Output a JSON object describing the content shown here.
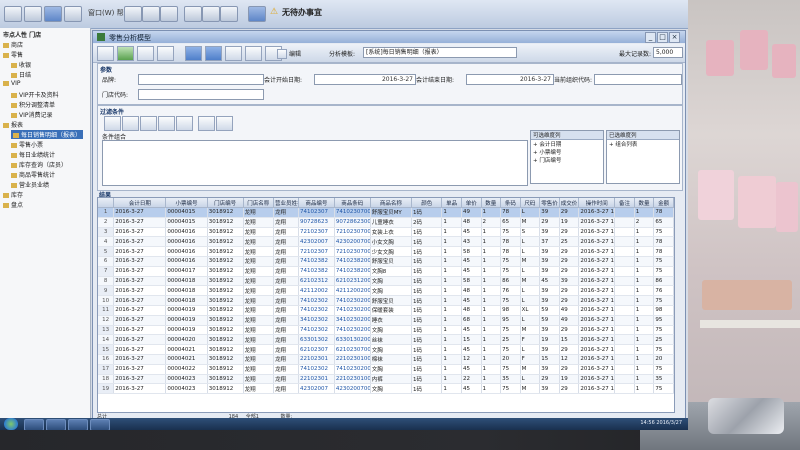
{
  "topbar": {
    "notice": "无待办事宜",
    "menu_text": "窗口(W)  帮助(H)"
  },
  "nav": {
    "store_title": "市点人性 门店",
    "items": [
      {
        "label": "商店",
        "level": 0
      },
      {
        "label": "零售",
        "level": 0
      },
      {
        "label": "收银",
        "level": 1
      },
      {
        "label": "日结",
        "level": 1
      },
      {
        "label": "VIP",
        "level": 0
      },
      {
        "label": "VIP开卡及资料",
        "level": 1
      },
      {
        "label": "积分调整清单",
        "level": 1
      },
      {
        "label": "VIP消费记录",
        "level": 1
      },
      {
        "label": "报表",
        "level": 0
      },
      {
        "label": "每日销售明细（报表）",
        "level": 1,
        "selected": true
      },
      {
        "label": "零售小票",
        "level": 1
      },
      {
        "label": "每日业绩统计",
        "level": 1
      },
      {
        "label": "库存查询（店员）",
        "level": 1
      },
      {
        "label": "商品零售统计",
        "level": 1
      },
      {
        "label": "营业员业绩",
        "level": 1
      },
      {
        "label": "库存",
        "level": 0
      },
      {
        "label": "盘点",
        "level": 0
      }
    ]
  },
  "window": {
    "title": "零售分析模型",
    "toolbar": {
      "edit_label": "编辑",
      "template_label": "分析模板:",
      "template_value": "[系统]每日销售明细（报表）",
      "max_records_label": "最大记录数:",
      "max_records_value": "5,000"
    },
    "params": {
      "section_title": "参数",
      "product_label": "品牌:",
      "store_label": "门店代码:",
      "start_label": "会计开始日期:",
      "start_value": "2016-3-27",
      "end_label": "会计结束日期:",
      "end_value": "2016-3-27",
      "vip_label": "当前组织代码:"
    },
    "filter": {
      "section_title": "过滤条件",
      "cond_title": "条件组合",
      "options_header": "可选维度列",
      "options": [
        "+ 会计日期",
        "+ 小票编号",
        "+ 门店编号"
      ],
      "selected_header": "已选维度列",
      "selected": [
        "+ 组合列表"
      ]
    },
    "grid": {
      "section_title": "结果",
      "columns": [
        "会计日期",
        "小票编号",
        "门店编号",
        "门店名称",
        "营业员姓名",
        "商品编号",
        "商品条码",
        "商品名称",
        "颜色",
        "单品",
        "单价",
        "数量",
        "条码",
        "尺码",
        "零售价",
        "成交价",
        "操作时间",
        "备注",
        "数量",
        "金额"
      ],
      "rows": [
        [
          "2016-3-27",
          "00004015",
          "3018912",
          "龙翔",
          "龙翔",
          "74102307",
          "74102307001",
          "舒服宝贝MY",
          "1码",
          "1",
          "49",
          "1",
          "78",
          "L",
          "39",
          "29",
          "2016-3-27 14:36",
          "",
          "1",
          "78"
        ],
        [
          "2016-3-27",
          "00004015",
          "3018912",
          "龙翔",
          "龙翔",
          "90728623",
          "90728623005",
          "儿童睡衣",
          "2码",
          "1",
          "48",
          "2",
          "65",
          "M",
          "29",
          "19",
          "2016-3-27 14:36",
          "",
          "2",
          "65"
        ],
        [
          "2016-3-27",
          "00004016",
          "3018912",
          "龙翔",
          "龙翔",
          "72102307",
          "72102307001",
          "女装上衣",
          "1码",
          "1",
          "45",
          "1",
          "75",
          "S",
          "39",
          "29",
          "2016-3-27 14:37",
          "",
          "1",
          "75"
        ],
        [
          "2016-3-27",
          "00004016",
          "3018912",
          "龙翔",
          "龙翔",
          "42302007",
          "42302007001",
          "小女文胸",
          "1码",
          "1",
          "43",
          "1",
          "78",
          "L",
          "37",
          "25",
          "2016-3-27 14:38",
          "",
          "1",
          "78"
        ],
        [
          "2016-3-27",
          "00004016",
          "3018912",
          "龙翔",
          "龙翔",
          "72102307",
          "72102307001",
          "少女文胸",
          "1码",
          "1",
          "58",
          "1",
          "78",
          "L",
          "39",
          "29",
          "2016-3-27 14:40",
          "",
          "1",
          "78"
        ],
        [
          "2016-3-27",
          "00004016",
          "3018912",
          "龙翔",
          "龙翔",
          "74102382",
          "74102382004",
          "舒服宝贝",
          "1码",
          "1",
          "45",
          "1",
          "75",
          "M",
          "39",
          "29",
          "2016-3-27 14:41",
          "",
          "1",
          "75"
        ],
        [
          "2016-3-27",
          "00004017",
          "3018912",
          "龙翔",
          "龙翔",
          "74102382",
          "74102382005",
          "文胸8",
          "1码",
          "1",
          "45",
          "1",
          "75",
          "L",
          "39",
          "29",
          "2016-3-27 14:41",
          "",
          "1",
          "75"
        ],
        [
          "2016-3-27",
          "00004018",
          "3018912",
          "龙翔",
          "龙翔",
          "62102312",
          "62102312006",
          "文胸",
          "1码",
          "1",
          "58",
          "1",
          "86",
          "M",
          "45",
          "39",
          "2016-3-27 14:42",
          "",
          "1",
          "86"
        ],
        [
          "2016-3-27",
          "00004018",
          "3018912",
          "龙翔",
          "龙翔",
          "42112002",
          "42112002001",
          "文胸",
          "1码",
          "1",
          "48",
          "1",
          "76",
          "L",
          "39",
          "29",
          "2016-3-27 14:43",
          "",
          "1",
          "76"
        ],
        [
          "2016-3-27",
          "00004018",
          "3018912",
          "龙翔",
          "龙翔",
          "74102302",
          "74102302007",
          "舒服宝贝",
          "1码",
          "1",
          "45",
          "1",
          "75",
          "L",
          "39",
          "29",
          "2016-3-27 14:44",
          "",
          "1",
          "75"
        ],
        [
          "2016-3-27",
          "00004019",
          "3018912",
          "龙翔",
          "龙翔",
          "74102302",
          "74102302006",
          "保暖套装",
          "1码",
          "1",
          "48",
          "1",
          "98",
          "XL",
          "59",
          "49",
          "2016-3-27 14:45",
          "",
          "1",
          "98"
        ],
        [
          "2016-3-27",
          "00004019",
          "3018912",
          "龙翔",
          "龙翔",
          "34102302",
          "34102302001",
          "睡衣",
          "1码",
          "1",
          "68",
          "1",
          "95",
          "L",
          "59",
          "49",
          "2016-3-27 14:46",
          "",
          "1",
          "95"
        ],
        [
          "2016-3-27",
          "00004019",
          "3018912",
          "龙翔",
          "龙翔",
          "74102302",
          "74102302001",
          "文胸",
          "1码",
          "1",
          "45",
          "1",
          "75",
          "M",
          "39",
          "29",
          "2016-3-27 14:47",
          "",
          "1",
          "75"
        ],
        [
          "2016-3-27",
          "00004020",
          "3018912",
          "龙翔",
          "龙翔",
          "63301302",
          "63301302001",
          "丝袜",
          "1码",
          "1",
          "15",
          "1",
          "25",
          "F",
          "19",
          "15",
          "2016-3-27 14:48",
          "",
          "1",
          "25"
        ],
        [
          "2016-3-27",
          "00004021",
          "3018912",
          "龙翔",
          "龙翔",
          "62102307",
          "62102307001",
          "文胸",
          "1码",
          "1",
          "45",
          "1",
          "75",
          "L",
          "39",
          "29",
          "2016-3-27 14:49",
          "",
          "1",
          "75"
        ],
        [
          "2016-3-27",
          "00004021",
          "3018912",
          "龙翔",
          "龙翔",
          "22102301",
          "22102301001",
          "棉袜",
          "1码",
          "1",
          "12",
          "1",
          "20",
          "F",
          "15",
          "12",
          "2016-3-27 14:50",
          "",
          "1",
          "20"
        ],
        [
          "2016-3-27",
          "00004022",
          "3018912",
          "龙翔",
          "龙翔",
          "74102302",
          "74102302008",
          "文胸",
          "1码",
          "1",
          "45",
          "1",
          "75",
          "M",
          "39",
          "29",
          "2016-3-27 14:51",
          "",
          "1",
          "75"
        ],
        [
          "2016-3-27",
          "00004023",
          "3018912",
          "龙翔",
          "龙翔",
          "22102301",
          "22102301003",
          "内裤",
          "1码",
          "1",
          "22",
          "1",
          "35",
          "L",
          "29",
          "19",
          "2016-3-27 14:52",
          "",
          "1",
          "35"
        ],
        [
          "2016-3-27",
          "00004023",
          "3018912",
          "龙翔",
          "龙翔",
          "42302007",
          "42302007002",
          "文胸",
          "1码",
          "1",
          "45",
          "1",
          "75",
          "M",
          "39",
          "29",
          "2016-3-27 14:53",
          "",
          "1",
          "75"
        ]
      ]
    },
    "status": {
      "total_label": "总计",
      "records": "184",
      "dept": "全部1",
      "count_label": "数量:"
    }
  },
  "taskbar": {
    "clock_time": "14:56",
    "clock_date": "2016/3/27"
  }
}
